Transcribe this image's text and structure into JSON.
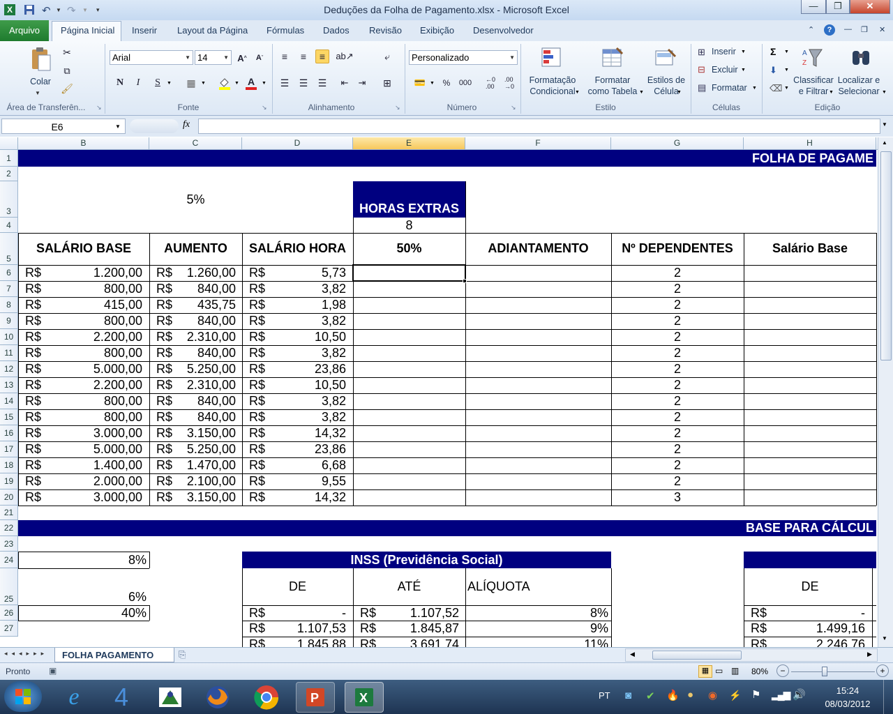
{
  "window": {
    "title": "Deduções da Folha de Pagamento.xlsx - Microsoft Excel",
    "minimize": "—",
    "restore": "❐",
    "close": "✕"
  },
  "tabs": {
    "file": "Arquivo",
    "items": [
      "Página Inicial",
      "Inserir",
      "Layout da Página",
      "Fórmulas",
      "Dados",
      "Revisão",
      "Exibição",
      "Desenvolvedor"
    ]
  },
  "ribbon": {
    "clipboard": {
      "paste": "Colar",
      "group": "Área de Transferên..."
    },
    "font": {
      "name": "Arial",
      "size": "14",
      "group": "Fonte",
      "bold": "N",
      "italic": "I",
      "underline": "S"
    },
    "alignment": {
      "group": "Alinhamento"
    },
    "number": {
      "format": "Personalizado",
      "group": "Número",
      "percent": "%",
      "thousands": "000"
    },
    "styles": {
      "cond_fmt": "Formatação\nCondicional",
      "fmt_table": "Formatar\ncomo Tabela",
      "cell_styles": "Estilos de\nCélula",
      "group": "Estilo"
    },
    "cells": {
      "insert": "Inserir",
      "delete": "Excluir",
      "format": "Formatar",
      "group": "Células"
    },
    "editing": {
      "sort": "Classificar\ne Filtrar",
      "find": "Localizar e\nSelecionar",
      "group": "Edição"
    }
  },
  "formula": {
    "name_box": "E6",
    "fx": "fx",
    "value": ""
  },
  "columns": [
    "B",
    "C",
    "D",
    "E",
    "F",
    "G",
    "H"
  ],
  "rows": [
    "1",
    "2",
    "3",
    "4",
    "5",
    "6",
    "7",
    "8",
    "9",
    "10",
    "11",
    "12",
    "13",
    "14",
    "15",
    "16",
    "17",
    "18",
    "19",
    "20",
    "21",
    "22",
    "23",
    "24",
    "25",
    "26",
    "27"
  ],
  "sheet": {
    "title1": "FOLHA DE PAGAME",
    "pct_aumento": "5%",
    "horas_extras": "HORAS EXTRAS",
    "horas_val": "8",
    "headers": [
      "SALÁRIO BASE",
      "AUMENTO",
      "SALÁRIO HORA",
      "50%",
      "ADIANTAMENTO",
      "Nº DEPENDENTES",
      "Salário Base"
    ],
    "currency": "R$",
    "data": [
      [
        "1.200,00",
        "1.260,00",
        "5,73",
        "2"
      ],
      [
        "800,00",
        "840,00",
        "3,82",
        "2"
      ],
      [
        "415,00",
        "435,75",
        "1,98",
        "2"
      ],
      [
        "800,00",
        "840,00",
        "3,82",
        "2"
      ],
      [
        "2.200,00",
        "2.310,00",
        "10,50",
        "2"
      ],
      [
        "800,00",
        "840,00",
        "3,82",
        "2"
      ],
      [
        "5.000,00",
        "5.250,00",
        "23,86",
        "2"
      ],
      [
        "2.200,00",
        "2.310,00",
        "10,50",
        "2"
      ],
      [
        "800,00",
        "840,00",
        "3,82",
        "2"
      ],
      [
        "800,00",
        "840,00",
        "3,82",
        "2"
      ],
      [
        "3.000,00",
        "3.150,00",
        "14,32",
        "2"
      ],
      [
        "5.000,00",
        "5.250,00",
        "23,86",
        "2"
      ],
      [
        "1.400,00",
        "1.470,00",
        "6,68",
        "2"
      ],
      [
        "2.000,00",
        "2.100,00",
        "9,55",
        "2"
      ],
      [
        "3.000,00",
        "3.150,00",
        "14,32",
        "3"
      ]
    ],
    "title2": "BASE PARA CÁLCUL",
    "b24": "8%",
    "b25": "6%",
    "b26": "40%",
    "inss": "INSS (Previdência Social)",
    "de": "DE",
    "ate": "ATÉ",
    "aliquota": "ALÍQUOTA",
    "r26": {
      "d": "-",
      "e": "1.107,52",
      "f": "8%",
      "h": "-"
    },
    "r27": {
      "d": "1.107,53",
      "e": "1.845,87",
      "f": "9%",
      "h": "1.499,16"
    },
    "r28": {
      "d": "1.845,88",
      "e": "3.691,74",
      "f": "11%",
      "h": "2.246,76"
    }
  },
  "sheet_tab": "FOLHA PAGAMENTO",
  "status": {
    "ready": "Pronto",
    "zoom": "80%"
  },
  "taskbar": {
    "lang": "PT",
    "time": "15:24",
    "date": "08/03/2012"
  }
}
